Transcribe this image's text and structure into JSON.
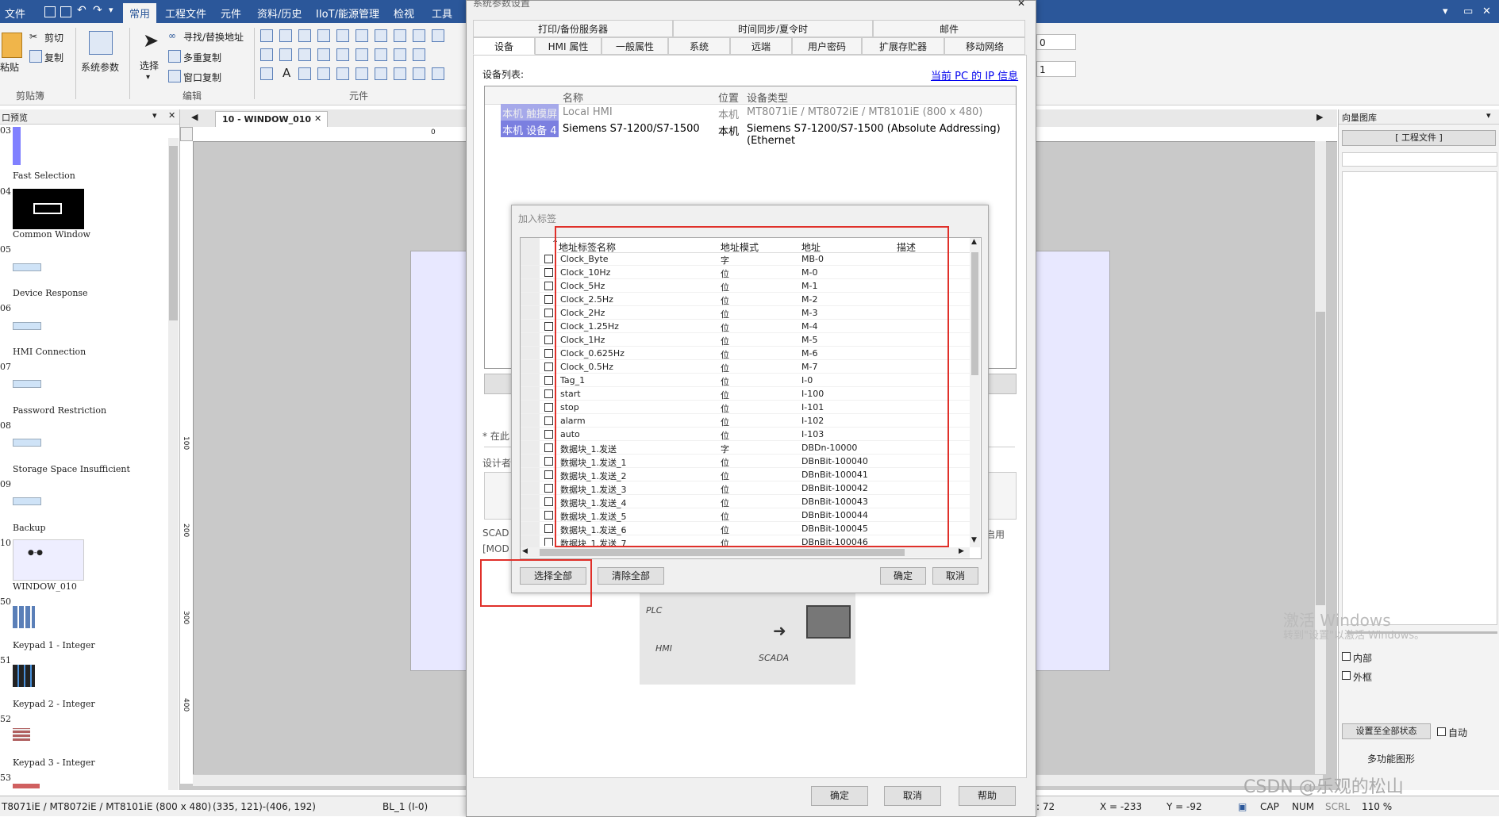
{
  "menubar": {
    "items": [
      "文件",
      "常用",
      "工程文件",
      "元件",
      "资料/历史",
      "IIoT/能源管理",
      "检视",
      "工具"
    ],
    "window_controls": [
      "▾",
      "▭",
      "✕"
    ]
  },
  "ribbon": {
    "paste": "粘贴",
    "cut": "剪切",
    "copy": "复制",
    "group_clipboard": "剪贴簿",
    "system_params": "系统参数",
    "select": "选择",
    "find_replace": "寻找/替换地址",
    "multi_copy": "多重复制",
    "window_copy": "窗口复制",
    "group_edit": "编辑",
    "group_objects": "元件",
    "num_field_1": "0",
    "num_field_2": "1"
  },
  "left_panel": {
    "title": "口预览",
    "thumbnails": [
      {
        "no": "03",
        "name": "Fast Selection"
      },
      {
        "no": "04",
        "name": "Common Window"
      },
      {
        "no": "05",
        "name": "Device Response"
      },
      {
        "no": "06",
        "name": "HMI Connection"
      },
      {
        "no": "07",
        "name": "Password Restriction"
      },
      {
        "no": "08",
        "name": "Storage Space Insufficient"
      },
      {
        "no": "09",
        "name": "Backup"
      },
      {
        "no": "10",
        "name": "WINDOW_010"
      },
      {
        "no": "50",
        "name": "Keypad 1 - Integer"
      },
      {
        "no": "51",
        "name": "Keypad 2 - Integer"
      },
      {
        "no": "52",
        "name": "Keypad 3 - Integer"
      },
      {
        "no": "53",
        "name": ""
      }
    ]
  },
  "editor": {
    "tab_label": "10 - WINDOW_010",
    "ruler_marks": [
      "0",
      "100",
      "200",
      "300",
      "400"
    ]
  },
  "right_panel": {
    "title": "向量图库",
    "project_file_btn": "[ 工程文件 ]",
    "internal": "内部",
    "external": "外框",
    "set_all_btn": "设置至全部状态",
    "auto": "自动",
    "multi_function": "多功能图形",
    "watermark_1": "激活 Windows",
    "watermark_2": "转到\"设置\"以激活 Windows。",
    "watermark_csdn": "CSDN @乐观的松山"
  },
  "statusbar": {
    "model": "T8071iE / MT8072iE / MT8101iE (800 x 480)",
    "coords": "(335, 121)-(406, 192)",
    "object": "BL_1 (I-0)",
    "value_72": ": 72",
    "x": "X = -233",
    "y": "Y = -92",
    "cap": "CAP",
    "num": "NUM",
    "scrl": "SCRL",
    "zoom": "110 %"
  },
  "main_dialog": {
    "title": "系统参数设置",
    "tabs_top": [
      "打印/备份服务器",
      "时间同步/夏令时",
      "邮件"
    ],
    "tabs_bottom": [
      "设备",
      "HMI 属性",
      "一般属性",
      "系统",
      "远端",
      "用户密码",
      "扩展存贮器",
      "移动网络"
    ],
    "device_list_label": "设备列表:",
    "ip_link": "当前 PC 的 IP 信息",
    "columns": [
      "名称",
      "位置",
      "设备类型"
    ],
    "rows": [
      {
        "id": "本机 触摸屏",
        "name": "Local HMI",
        "loc": "本机",
        "type": "MT8071iE / MT8072iE / MT8101iE (800 x 480)"
      },
      {
        "id": "本机 设备 4",
        "name": "Siemens S7-1200/S7-1500",
        "loc": "本机",
        "type": "Siemens S7-1200/S7-1500 (Absolute Addressing) (Ethernet"
      }
    ],
    "note_here": "* 在此",
    "designer": "设计者",
    "scada": "SCAD",
    "mod": "[MOD",
    "enabled": "启用",
    "graphic_plc": "PLC",
    "graphic_hmi": "HMI",
    "graphic_scada": "SCADA",
    "ok": "确定",
    "cancel": "取消",
    "help": "帮助"
  },
  "tag_dialog": {
    "title": "加入标签",
    "columns": [
      "地址标签名称",
      "地址模式",
      "地址",
      "描述"
    ],
    "rows": [
      {
        "name": "Clock_Byte",
        "mode": "字",
        "addr": "MB-0"
      },
      {
        "name": "Clock_10Hz",
        "mode": "位",
        "addr": "M-0"
      },
      {
        "name": "Clock_5Hz",
        "mode": "位",
        "addr": "M-1"
      },
      {
        "name": "Clock_2.5Hz",
        "mode": "位",
        "addr": "M-2"
      },
      {
        "name": "Clock_2Hz",
        "mode": "位",
        "addr": "M-3"
      },
      {
        "name": "Clock_1.25Hz",
        "mode": "位",
        "addr": "M-4"
      },
      {
        "name": "Clock_1Hz",
        "mode": "位",
        "addr": "M-5"
      },
      {
        "name": "Clock_0.625Hz",
        "mode": "位",
        "addr": "M-6"
      },
      {
        "name": "Clock_0.5Hz",
        "mode": "位",
        "addr": "M-7"
      },
      {
        "name": "Tag_1",
        "mode": "位",
        "addr": "I-0"
      },
      {
        "name": "start",
        "mode": "位",
        "addr": "I-100"
      },
      {
        "name": "stop",
        "mode": "位",
        "addr": "I-101"
      },
      {
        "name": "alarm",
        "mode": "位",
        "addr": "I-102"
      },
      {
        "name": "auto",
        "mode": "位",
        "addr": "I-103"
      },
      {
        "name": "数据块_1.发送",
        "mode": "字",
        "addr": "DBDn-10000"
      },
      {
        "name": "数据块_1.发送_1",
        "mode": "位",
        "addr": "DBnBit-100040"
      },
      {
        "name": "数据块_1.发送_2",
        "mode": "位",
        "addr": "DBnBit-100041"
      },
      {
        "name": "数据块_1.发送_3",
        "mode": "位",
        "addr": "DBnBit-100042"
      },
      {
        "name": "数据块_1.发送_4",
        "mode": "位",
        "addr": "DBnBit-100043"
      },
      {
        "name": "数据块_1.发送_5",
        "mode": "位",
        "addr": "DBnBit-100044"
      },
      {
        "name": "数据块_1.发送_6",
        "mode": "位",
        "addr": "DBnBit-100045"
      },
      {
        "name": "数据块_1.发送_7",
        "mode": "位",
        "addr": "DBnBit-100046"
      }
    ],
    "select_all": "选择全部",
    "clear_all": "清除全部",
    "ok": "确定",
    "cancel": "取消"
  },
  "colors": {
    "title_blue": "#2b579a",
    "highlight_red": "#e0302a",
    "selection_purple": "#7b7fe0"
  }
}
